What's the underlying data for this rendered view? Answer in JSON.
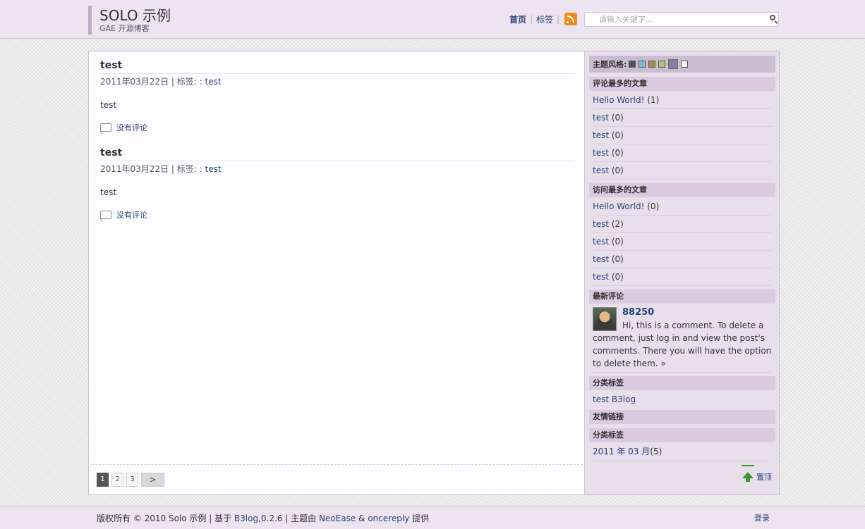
{
  "header": {
    "title": "SOLO 示例",
    "subtitle": "GAE 开源博客",
    "nav": {
      "home": "首页",
      "tags": "标签"
    },
    "search_placeholder": "请输入关键字..."
  },
  "articles": [
    {
      "title": "test",
      "date": "2011年03月22日",
      "tag_prefix": " | 标签: : ",
      "tag": "test",
      "abstract": "test",
      "comments": "没有评论"
    },
    {
      "title": "test",
      "date": "2011年03月22日",
      "tag_prefix": " | 标签: : ",
      "tag": "test",
      "abstract": "test",
      "comments": "没有评论"
    }
  ],
  "pagination": {
    "pages": [
      "1",
      "2",
      "3"
    ],
    "current": "1",
    "next": ">"
  },
  "sidebar": {
    "theme_label": "主题风格:",
    "theme_colors": [
      "#555555",
      "#7fb6d6",
      "#b08a45",
      "#a9c46a",
      "#8c7fa8",
      "#ffffff"
    ],
    "most_commented": {
      "title": "评论最多的文章",
      "items": [
        {
          "label": "Hello World!",
          "count": " (1)"
        },
        {
          "label": "test",
          "count": " (0)"
        },
        {
          "label": "test",
          "count": " (0)"
        },
        {
          "label": "test",
          "count": " (0)"
        },
        {
          "label": "test",
          "count": " (0)"
        }
      ]
    },
    "most_viewed": {
      "title": "访问最多的文章",
      "items": [
        {
          "label": "Hello World!",
          "count": " (0)"
        },
        {
          "label": "test",
          "count": " (2)"
        },
        {
          "label": "test",
          "count": " (0)"
        },
        {
          "label": "test",
          "count": " (0)"
        },
        {
          "label": "test",
          "count": " (0)"
        }
      ]
    },
    "recent_comments": {
      "title": "最新评论",
      "author": "88250",
      "text": "Hi, this is a comment. To delete a comment, just log in and view the post's comments. There you will have the option to delete them. »"
    },
    "tags": {
      "title": "分类标签",
      "items": [
        "test",
        "B3log"
      ]
    },
    "links": {
      "title": "友情链接"
    },
    "archives": {
      "title": "分类标签",
      "label": "2011 年 03 月",
      "count": "(5)"
    },
    "top": "置顶"
  },
  "footer": {
    "copyright": "版权所有 © 2010 Solo 示例 | 基于 ",
    "b3log": "B3log",
    "version": ",0.2.6 | 主题由 ",
    "neoease": "NeoEase",
    "amp": " & ",
    "oncereply": "oncereply",
    "provided": " 提供",
    "login": "登录"
  }
}
